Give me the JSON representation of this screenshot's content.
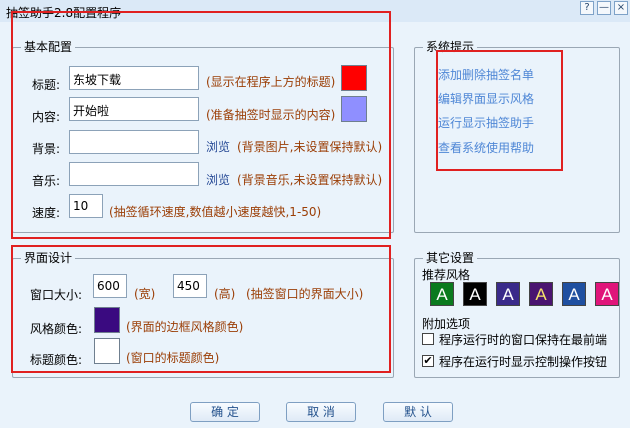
{
  "window": {
    "title": "抽签助手2.8配置程序",
    "help_glyph": "?",
    "minimize_glyph": "—",
    "close_glyph": "×"
  },
  "basic": {
    "legend": "基本配置",
    "title_label": "标题:",
    "title_value": "东坡下载",
    "title_hint": "(显示在程序上方的标题)",
    "title_color": "#ff0000",
    "content_label": "内容:",
    "content_value": "开始啦",
    "content_hint": "(准备抽签时显示的内容)",
    "content_color": "#8f8fff",
    "bg_label": "背景:",
    "bg_value": "",
    "bg_browse": "浏览",
    "bg_hint": "(背景图片,未设置保持默认)",
    "music_label": "音乐:",
    "music_value": "",
    "music_browse": "浏览",
    "music_hint": "(背景音乐,未设置保持默认)",
    "speed_label": "速度:",
    "speed_value": "10",
    "speed_hint": "(抽签循环速度,数值越小速度越快,1-50)"
  },
  "tips": {
    "legend": "系统提示",
    "links": [
      "添加删除抽签名单",
      "编辑界面显示风格",
      "运行显示抽签助手",
      "查看系统使用帮助"
    ]
  },
  "ui": {
    "legend": "界面设计",
    "size_label": "窗口大小:",
    "width_value": "600",
    "width_unit": "(宽)",
    "height_value": "450",
    "height_unit": "(高)",
    "size_hint": "(抽签窗口的界面大小)",
    "style_color_label": "风格颜色:",
    "style_color": "#3a0a80",
    "style_color_hint": "(界面的边框风格颜色)",
    "title_color_label": "标题颜色:",
    "title_color": "#ffffff",
    "title_color_hint": "(窗口的标题颜色)"
  },
  "other": {
    "legend": "其它设置",
    "styles_label": "推荐风格",
    "styles": [
      {
        "letter": "A",
        "bg": "#0a7a1e",
        "fg": "#ffffff"
      },
      {
        "letter": "A",
        "bg": "#000000",
        "fg": "#ffffff"
      },
      {
        "letter": "A",
        "bg": "#3a2a8a",
        "fg": "#ffffff"
      },
      {
        "letter": "A",
        "bg": "#4a1470",
        "fg": "#f6e36a"
      },
      {
        "letter": "A",
        "bg": "#1f4fa0",
        "fg": "#ffffff"
      },
      {
        "letter": "A",
        "bg": "#e0157a",
        "fg": "#ffffff"
      }
    ],
    "extra_label": "附加选项",
    "opt1_label": "程序运行时的窗口保持在最前端",
    "opt1_checked": false,
    "opt2_label": "程序在运行时显示控制操作按钮",
    "opt2_checked": true
  },
  "buttons": {
    "ok": "确 定",
    "cancel": "取 消",
    "default": "默 认"
  }
}
